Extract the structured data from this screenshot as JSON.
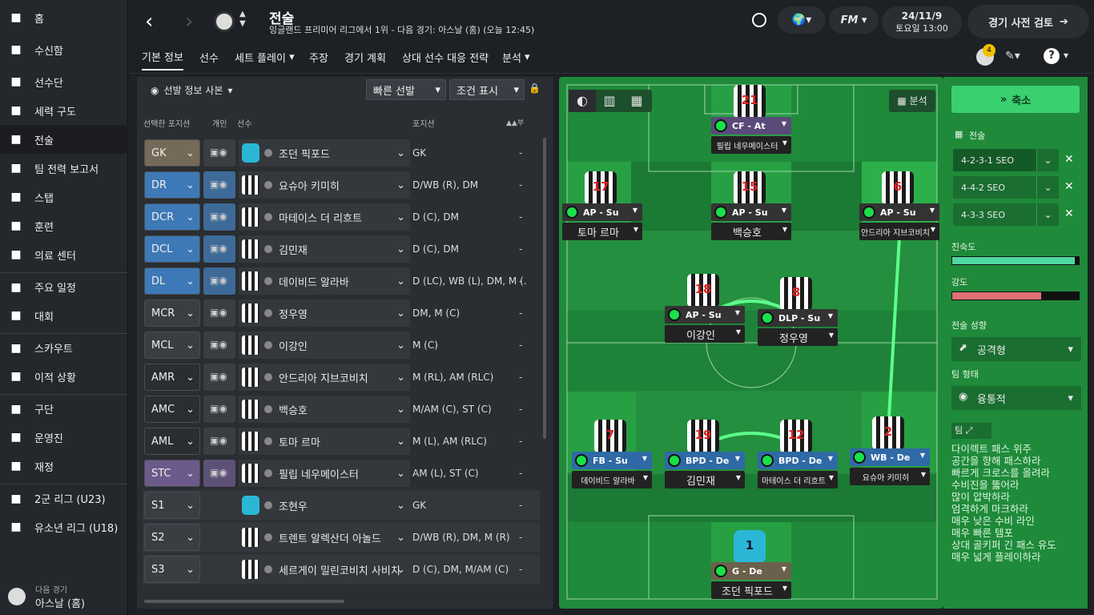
{
  "sidebar": {
    "items": [
      {
        "label": "홈",
        "icon": "home-icon"
      },
      {
        "label": "수신함",
        "icon": "inbox-icon"
      },
      {
        "label": "선수단",
        "icon": "squad-icon"
      },
      {
        "label": "세력 구도",
        "icon": "dynamics-icon"
      },
      {
        "label": "전술",
        "icon": "tactics-icon"
      },
      {
        "label": "팀 전력 보고서",
        "icon": "report-icon"
      },
      {
        "label": "스탭",
        "icon": "staff-icon"
      },
      {
        "label": "훈련",
        "icon": "training-icon"
      },
      {
        "label": "의료 센터",
        "icon": "medical-icon"
      },
      {
        "label": "주요 일정",
        "icon": "calendar-icon"
      },
      {
        "label": "대회",
        "icon": "trophy-icon"
      },
      {
        "label": "스카우트",
        "icon": "search-icon"
      },
      {
        "label": "이적 상황",
        "icon": "transfer-icon"
      },
      {
        "label": "구단",
        "icon": "shield-icon"
      },
      {
        "label": "운영진",
        "icon": "briefcase-icon"
      },
      {
        "label": "재정",
        "icon": "pound-icon"
      },
      {
        "label": "2군 리그 (U23)",
        "icon": "u23-icon"
      },
      {
        "label": "유소년 리그 (U18)",
        "icon": "u18-icon"
      }
    ],
    "next_label": "다음 경기",
    "next_match": "아스날 (홈)"
  },
  "header": {
    "title": "전술",
    "subtitle": "잉글랜드 프리미어 리그에서 1위 - 다음 경기: 아스날 (홈) (오늘 12:45)",
    "date": "24/11/9",
    "day_time": "토요일 13:00",
    "review_button": "경기 사전 검토",
    "notif_count": "4"
  },
  "tabs": [
    "기본 정보",
    "선수",
    "세트 플레이",
    "주장",
    "경기 계획",
    "상대 선수 대응 전략",
    "분석"
  ],
  "toolbar": {
    "copy_label": "선발 정보 사본",
    "quick_pick": "빠른 선발",
    "condition": "조건 표시"
  },
  "columns": {
    "selected_pos": "선택한 포지션",
    "individual": "개인",
    "player": "선수",
    "position": "포지션"
  },
  "rows": [
    {
      "pos": "GK",
      "color": "#756a57",
      "kit": "1",
      "gk": true,
      "name": "조던 픽포드",
      "positions": "GK",
      "ind": true
    },
    {
      "pos": "DR",
      "color": "#3d79b6",
      "kit": "2",
      "name": "요슈아 키미히",
      "positions": "D/WB (R), DM",
      "ind": true
    },
    {
      "pos": "DCR",
      "color": "#3d79b6",
      "kit": "12",
      "name": "마테이스 더 리흐트",
      "positions": "D (C), DM",
      "ind": true
    },
    {
      "pos": "DCL",
      "color": "#3d79b6",
      "kit": "19",
      "name": "김민재",
      "positions": "D (C), DM",
      "ind": true
    },
    {
      "pos": "DL",
      "color": "#3d79b6",
      "kit": "7",
      "name": "데이비드 알라바",
      "positions": "D (LC), WB (L), DM, M (...",
      "ind": true
    },
    {
      "pos": "MCR",
      "color": "#3a3d42",
      "kit": "8",
      "name": "정우영",
      "positions": "DM, M (C)",
      "ind": true
    },
    {
      "pos": "MCL",
      "color": "#3a3d42",
      "kit": "18",
      "name": "이강인",
      "positions": "M (C)",
      "ind": true
    },
    {
      "pos": "AMR",
      "color": "#2a2d31",
      "kit": "6",
      "name": "안드리아 지브코비치",
      "positions": "M (RL), AM (RLC)",
      "ind": true
    },
    {
      "pos": "AMC",
      "color": "#2a2d31",
      "kit": "15",
      "name": "백승호",
      "positions": "M/AM (C), ST (C)",
      "ind": true
    },
    {
      "pos": "AML",
      "color": "#2a2d31",
      "kit": "17",
      "name": "토마 르마",
      "positions": "M (L), AM (RLC)",
      "ind": true
    },
    {
      "pos": "STC",
      "color": "#6c5a8a",
      "kit": "21",
      "name": "필립 네우메이스터",
      "positions": "AM (L), ST (C)",
      "ind": true
    },
    {
      "pos": "S1",
      "color": "#3a3d42",
      "kit": "3",
      "gk": true,
      "name": "조현우",
      "positions": "GK",
      "ind": false
    },
    {
      "pos": "S2",
      "color": "#3a3d42",
      "kit": "4",
      "name": "트렌트 알렉산더 아놀드",
      "positions": "D/WB (R), DM, M (R)",
      "ind": false
    },
    {
      "pos": "S3",
      "color": "#3a3d42",
      "kit": "5",
      "name": "세르게이 밀린코비치 사비치",
      "positions": "D (C), DM, M/AM (C)",
      "ind": false
    }
  ],
  "pitch_players": [
    {
      "num": "21",
      "role": "CF - At",
      "name": "필립 네우메이스터",
      "tag": "#5a4a7a"
    },
    {
      "num": "17",
      "role": "AP - Su",
      "name": "토마 르마",
      "tag": "#333"
    },
    {
      "num": "15",
      "role": "AP - Su",
      "name": "백승호",
      "tag": "#333"
    },
    {
      "num": "6",
      "role": "AP - Su",
      "name": "안드리아 지브코비치",
      "tag": "#333"
    },
    {
      "num": "18",
      "role": "AP - Su",
      "name": "이강인",
      "tag": "#333"
    },
    {
      "num": "8",
      "role": "DLP - Su",
      "name": "정우영",
      "tag": "#333"
    },
    {
      "num": "7",
      "role": "FB - Su",
      "name": "데이비드 알라바",
      "tag": "#2f6aa6"
    },
    {
      "num": "19",
      "role": "BPD - De",
      "name": "김민재",
      "tag": "#2f6aa6"
    },
    {
      "num": "12",
      "role": "BPD - De",
      "name": "마테이스 더 리흐트",
      "tag": "#2f6aa6"
    },
    {
      "num": "2",
      "role": "WB - De",
      "name": "요슈아 키미히",
      "tag": "#2f6aa6"
    },
    {
      "num": "1",
      "role": "G - De",
      "name": "조던 픽포드",
      "tag": "#6b604c"
    }
  ],
  "right": {
    "collapse": "축소",
    "analysis": "분석",
    "tactic_label": "전술",
    "formations": [
      "4-2-3-1 SEO",
      "4-4-2 SEO",
      "4-3-3 SEO"
    ],
    "familiarity": "친숙도",
    "familiarity_value": 0.97,
    "intensity": "강도",
    "intensity_value": 0.7,
    "mentality_label": "전술 성향",
    "mentality": "공격형",
    "shape_label": "팀 형태",
    "shape": "융통적",
    "team_label": "팀",
    "instructions": [
      "다이렉트 패스 위주",
      "공간을 향해 패스하라",
      "빠르게 크로스를 올려라",
      "수비진을 뚫어라",
      "많이 압박하라",
      "엄격하게 마크하라",
      "매우 낮은 수비 라인",
      "매우 빠른 템포",
      "상대 골키퍼 긴 패스 유도",
      "매우 넓게 플레이하라"
    ]
  }
}
